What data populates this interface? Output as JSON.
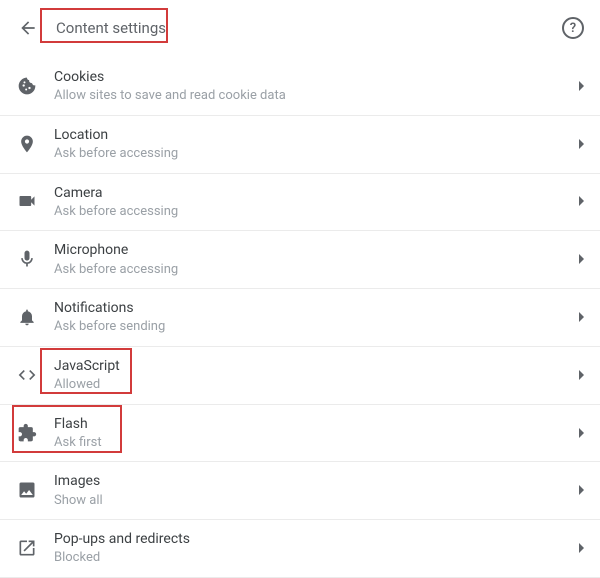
{
  "header": {
    "title": "Content settings"
  },
  "rows": [
    {
      "title": "Cookies",
      "sub": "Allow sites to save and read cookie data"
    },
    {
      "title": "Location",
      "sub": "Ask before accessing"
    },
    {
      "title": "Camera",
      "sub": "Ask before accessing"
    },
    {
      "title": "Microphone",
      "sub": "Ask before accessing"
    },
    {
      "title": "Notifications",
      "sub": "Ask before sending"
    },
    {
      "title": "JavaScript",
      "sub": "Allowed"
    },
    {
      "title": "Flash",
      "sub": "Ask first"
    },
    {
      "title": "Images",
      "sub": "Show all"
    },
    {
      "title": "Pop-ups and redirects",
      "sub": "Blocked"
    }
  ]
}
